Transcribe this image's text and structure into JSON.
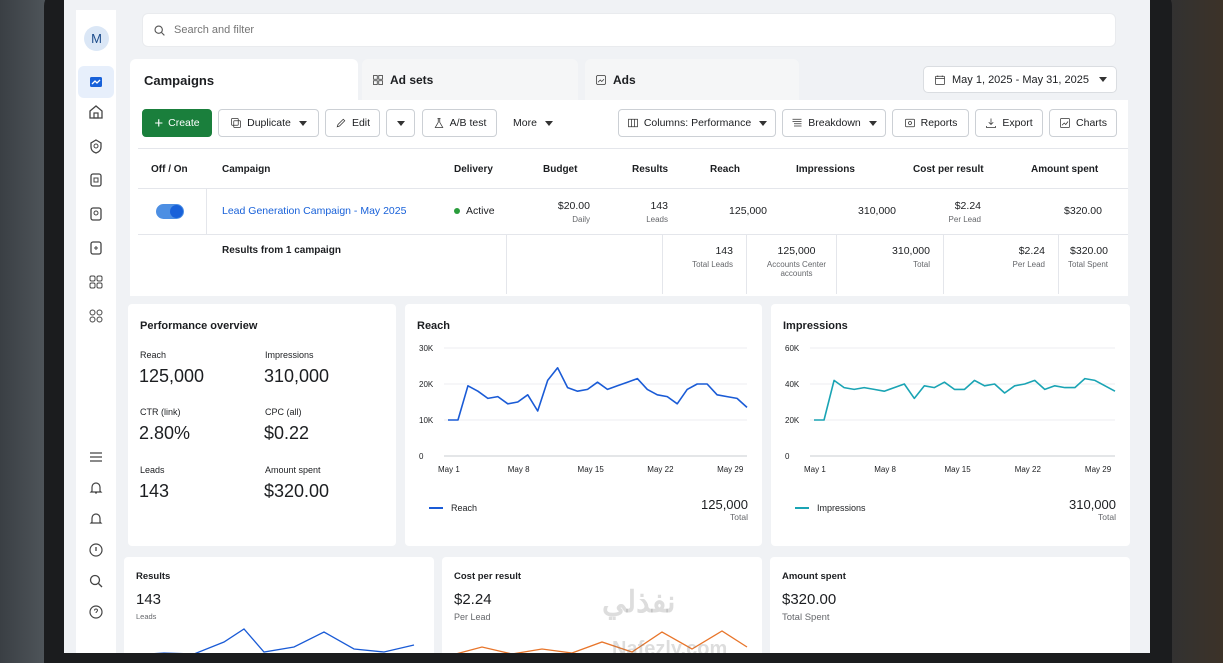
{
  "sidebar": {
    "avatar": "M"
  },
  "search": {
    "placeholder": "Search and filter"
  },
  "tabs": [
    {
      "label": "Campaigns"
    },
    {
      "label": "Ad sets"
    },
    {
      "label": "Ads"
    }
  ],
  "date_range": "May 1, 2025 - May 31, 2025",
  "toolbar": {
    "create": "Create",
    "duplicate": "Duplicate",
    "edit": "Edit",
    "ab_test": "A/B test",
    "more": "More",
    "columns": "Columns: Performance",
    "breakdown": "Breakdown",
    "reports": "Reports",
    "export": "Export",
    "charts": "Charts"
  },
  "table": {
    "headers": [
      "Off / On",
      "Campaign",
      "Delivery",
      "Budget",
      "Results",
      "Reach",
      "Impressions",
      "Cost per result",
      "Amount spent"
    ],
    "row": {
      "campaign": "Lead Generation Campaign - May 2025",
      "delivery": "Active",
      "budget": "$20.00",
      "budget_sub": "Daily",
      "results": "143",
      "results_sub": "Leads",
      "reach": "125,000",
      "impressions": "310,000",
      "cost": "$2.24",
      "cost_sub": "Per Lead",
      "spent": "$320.00"
    },
    "summary": {
      "label": "Results from 1 campaign",
      "results": "143",
      "results_sub": "Total Leads",
      "reach": "125,000",
      "reach_sub": "Accounts Center accounts",
      "impressions": "310,000",
      "impressions_sub": "Total",
      "cost": "$2.24",
      "cost_sub": "Per Lead",
      "spent": "$320.00",
      "spent_sub": "Total Spent"
    }
  },
  "overview": {
    "title": "Performance overview",
    "metrics": [
      {
        "label": "Reach",
        "value": "125,000"
      },
      {
        "label": "Impressions",
        "value": "310,000"
      },
      {
        "label": "CTR (link)",
        "value": "2.80%"
      },
      {
        "label": "CPC (all)",
        "value": "$0.22"
      },
      {
        "label": "Leads",
        "value": "143"
      },
      {
        "label": "Amount spent",
        "value": "$320.00"
      }
    ]
  },
  "chart_data": [
    {
      "type": "line",
      "title": "Reach",
      "x": [
        1,
        2,
        3,
        4,
        5,
        6,
        7,
        8,
        9,
        10,
        11,
        12,
        13,
        14,
        15,
        16,
        17,
        18,
        19,
        20,
        21,
        22,
        23,
        24,
        25,
        26,
        27,
        28,
        29,
        30,
        31
      ],
      "x_tick_labels": [
        "May 1",
        "May 8",
        "May 15",
        "May 22",
        "May 29"
      ],
      "x_ticks": [
        1,
        8,
        15,
        22,
        29
      ],
      "y_tick_labels": [
        "0",
        "10K",
        "20K",
        "30K"
      ],
      "ylim": [
        0,
        30000
      ],
      "series": [
        {
          "name": "Reach",
          "values": [
            10000,
            10000,
            19500,
            18000,
            16000,
            16500,
            14500,
            15000,
            17000,
            12500,
            21000,
            24500,
            19000,
            18000,
            18500,
            20500,
            18500,
            19500,
            20500,
            21500,
            18500,
            17000,
            16500,
            14500,
            18500,
            20000,
            20000,
            17000,
            16500,
            16000,
            13500
          ]
        }
      ],
      "total": "125,000",
      "total_label": "Total",
      "color": "#1a5bd6"
    },
    {
      "type": "line",
      "title": "Impressions",
      "x": [
        1,
        2,
        3,
        4,
        5,
        6,
        7,
        8,
        9,
        10,
        11,
        12,
        13,
        14,
        15,
        16,
        17,
        18,
        19,
        20,
        21,
        22,
        23,
        24,
        25,
        26,
        27,
        28,
        29,
        30,
        31
      ],
      "x_tick_labels": [
        "May 1",
        "May 8",
        "May 15",
        "May 22",
        "May 29"
      ],
      "x_ticks": [
        1,
        8,
        15,
        22,
        29
      ],
      "y_tick_labels": [
        "0",
        "20K",
        "40K",
        "60K"
      ],
      "ylim": [
        0,
        60000
      ],
      "series": [
        {
          "name": "Impressions",
          "values": [
            20000,
            20000,
            42000,
            38000,
            37000,
            38000,
            37000,
            36000,
            38000,
            40000,
            32000,
            39000,
            38000,
            41000,
            37000,
            37000,
            42000,
            39000,
            40000,
            35000,
            39000,
            40000,
            42000,
            37000,
            39000,
            38000,
            38000,
            43000,
            42000,
            39000,
            36000
          ]
        }
      ],
      "total": "310,000",
      "total_label": "Total",
      "color": "#1aa4b4"
    }
  ],
  "bottom_cards": [
    {
      "title": "Results",
      "value": "143",
      "sub": "Leads"
    },
    {
      "title": "Cost per result",
      "value": "$2.24",
      "sub": "Per Lead"
    },
    {
      "title": "Amount spent",
      "value": "$320.00",
      "sub": "Total Spent"
    }
  ],
  "watermark": {
    "line1": "نفذلي",
    "line2": "Nafezly.com"
  }
}
